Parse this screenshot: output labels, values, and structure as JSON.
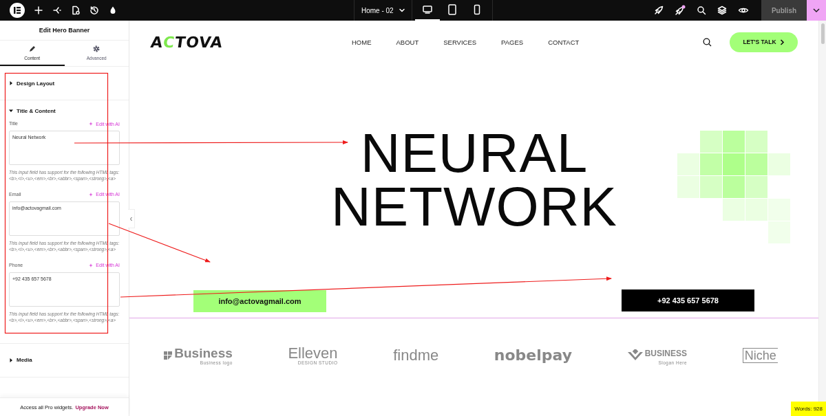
{
  "topbar": {
    "page_selector": "Home - 02",
    "notification": true,
    "devices": [
      {
        "kind": "desktop",
        "selected": true
      },
      {
        "kind": "tablet",
        "selected": false
      },
      {
        "kind": "mobile",
        "selected": false
      }
    ],
    "publish": {
      "label": "Publish",
      "disabled": true
    }
  },
  "panel": {
    "title": "Edit Hero Banner",
    "tabs": [
      {
        "label": "Content",
        "kind": "pencil",
        "selected": true
      },
      {
        "label": "Advanced",
        "kind": "gear",
        "selected": false
      }
    ],
    "sections": [
      {
        "title": "Design Layout",
        "expanded": false
      },
      {
        "title": "Title & Content",
        "expanded": true,
        "fields": [
          {
            "label": "Title",
            "ai_action": "Edit with AI",
            "value": "Neural Network",
            "help": "This input field has support for the following HTML tags: <b>,<i>,<u>,<em>,<br>,<abbr>,<span>,<strong>,<a>"
          },
          {
            "label": "Email",
            "ai_action": "Edit with AI",
            "value": "info@actovagmail.com",
            "help": "This input field has support for the following HTML tags: <b>,<i>,<u>,<em>,<br>,<abbr>,<span>,<strong>,<a>"
          },
          {
            "label": "Phone",
            "ai_action": "Edit with AI",
            "value": "+92 435 657 5678",
            "help": "This input field has support for the following HTML tags: <b>,<i>,<u>,<em>,<br>,<abbr>,<span>,<strong>,<a>"
          }
        ]
      },
      {
        "title": "Media",
        "expanded": false
      }
    ],
    "promo": {
      "text": "Access all Pro widgets.",
      "link": "Upgrade Now"
    }
  },
  "site": {
    "logo": "ACTOVA",
    "nav": [
      "HOME",
      "ABOUT",
      "SERVICES",
      "PAGES",
      "CONTACT"
    ],
    "cta": "LET'S TALK",
    "hero": {
      "title_lines": [
        "NEURAL",
        "NETWORK"
      ],
      "email": "info@actovagmail.com",
      "phone": "+92 435 657 5678"
    },
    "partners": [
      {
        "name": "Business",
        "tagline": "Business logo",
        "kind": "squares"
      },
      {
        "name": "Elleven",
        "tagline": "DESIGN STUDIO",
        "kind": "thin"
      },
      {
        "name": "findme",
        "kind": "thin"
      },
      {
        "name": "nobelpay",
        "kind": "round"
      },
      {
        "name": "BUSINESS",
        "tagline": "Slogan Here",
        "kind": "chevron"
      },
      {
        "name": "Niche",
        "kind": "boxed"
      }
    ]
  },
  "word_count": "Words: 928"
}
